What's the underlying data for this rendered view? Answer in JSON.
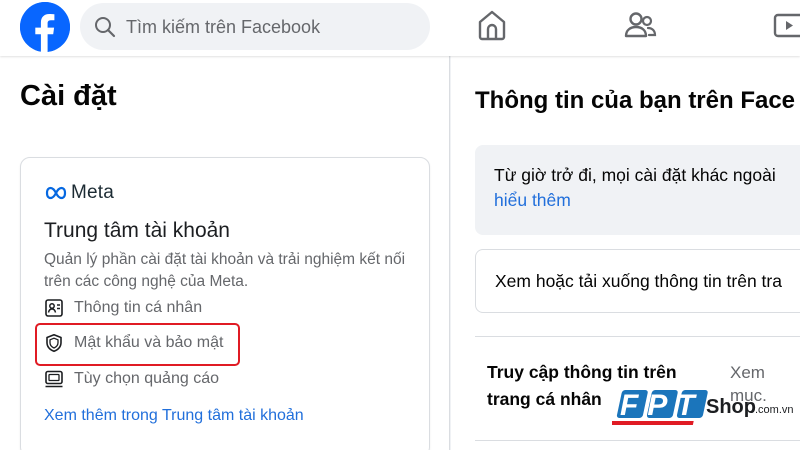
{
  "search": {
    "placeholder": "Tìm kiếm trên Facebook"
  },
  "nav": {
    "icons": [
      "home-icon",
      "friends-icon",
      "watch-icon"
    ]
  },
  "colors": {
    "brand": "#0866ff",
    "link": "#216fdb",
    "highlight_border": "#e01b24"
  },
  "settings": {
    "title": "Cài đặt"
  },
  "accounts_center": {
    "logo_text": "Meta",
    "title": "Trung tâm tài khoản",
    "description": "Quản lý phần cài đặt tài khoản và trải nghiệm kết nối trên các công nghệ của Meta.",
    "items": [
      {
        "label": "Thông tin cá nhân",
        "icon": "personal-info-icon"
      },
      {
        "label": "Mật khẩu và bảo mật",
        "icon": "shield-icon",
        "highlighted": true
      },
      {
        "label": "Tùy chọn quảng cáo",
        "icon": "ad-preferences-icon"
      }
    ],
    "see_more": "Xem thêm trong Trung tâm tài khoản"
  },
  "right": {
    "title": "Thông tin của bạn trên Face",
    "notice_text": "Từ giờ trở đi, mọi cài đặt khác ngoài",
    "notice_link": "hiểu thêm",
    "download_text": "Xem hoặc tải xuống thông tin trên tra",
    "access_label": "Truy cập thông tin trên trang cá nhân",
    "access_side_line1": "Xem",
    "access_side_line2": "mục."
  },
  "watermark": {
    "brand": "FPT",
    "shop": "Shop",
    "domain": ".com.vn"
  }
}
